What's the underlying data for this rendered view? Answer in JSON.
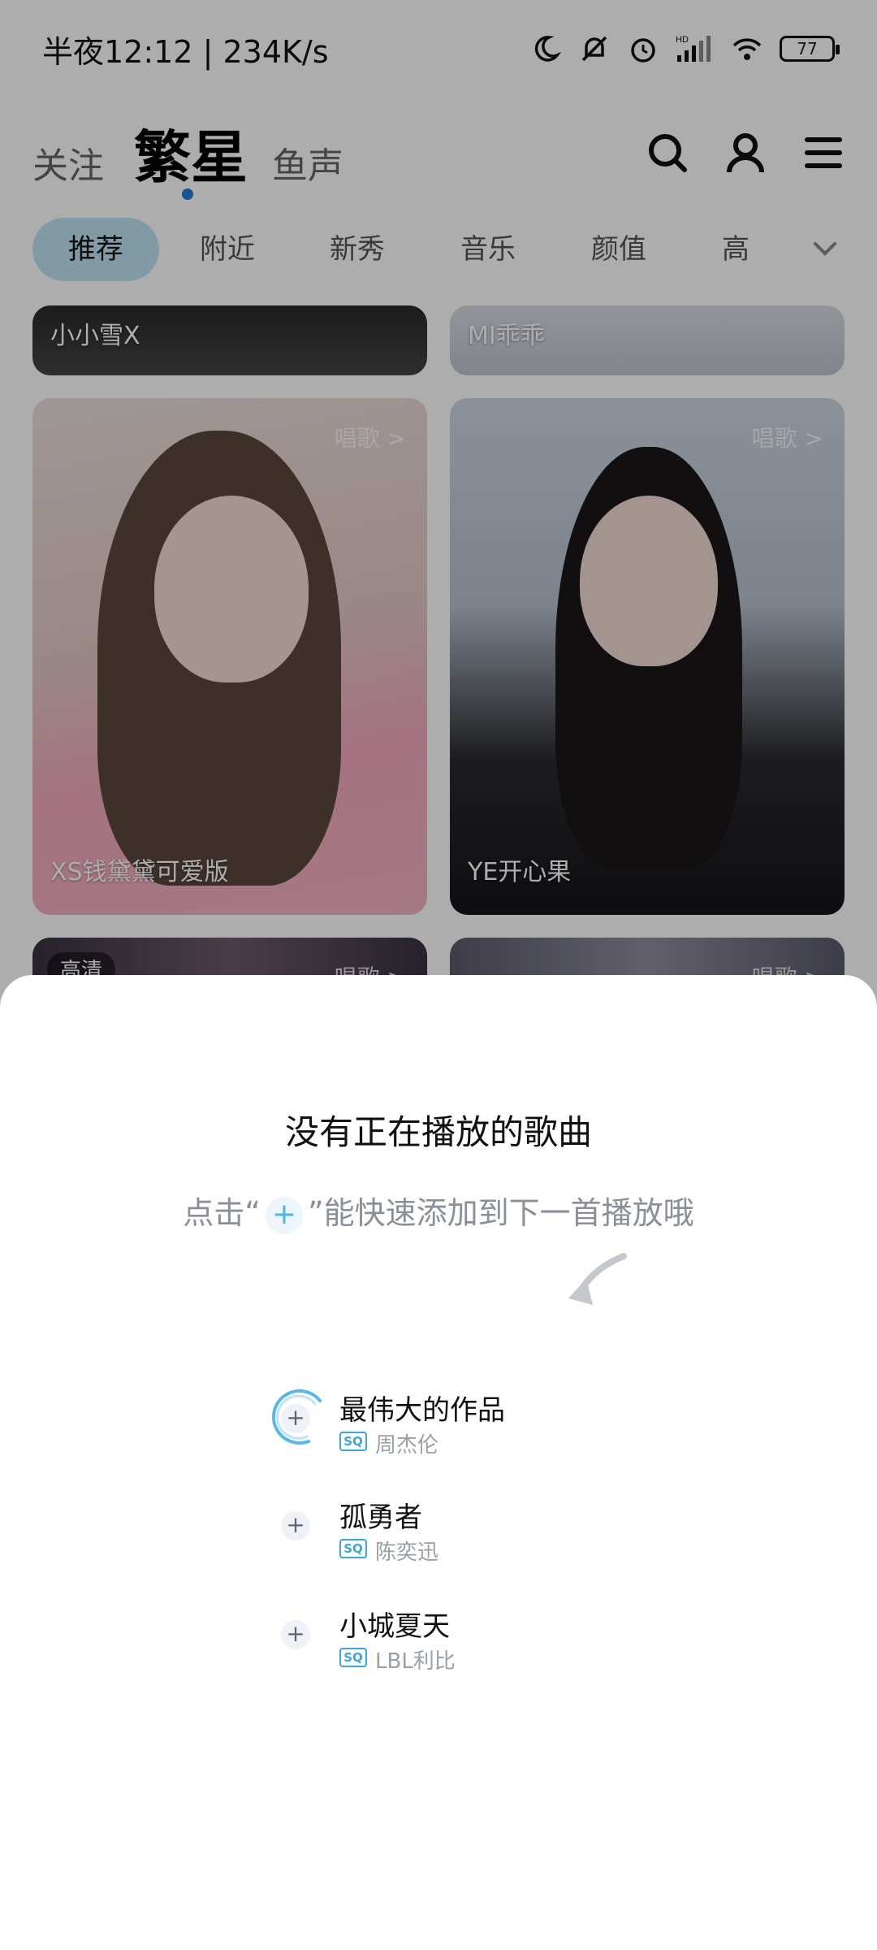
{
  "statusbar": {
    "time": "半夜12:12",
    "speed": "234K/s",
    "battery": "77",
    "icons": [
      "moon-icon",
      "bell-off-icon",
      "alarm-icon",
      "signal-hd-icon",
      "wifi-icon",
      "battery-icon"
    ]
  },
  "topnav": {
    "tab_follow": "关注",
    "tab_star": "繁星",
    "tab_fish": "鱼声",
    "icons": [
      "search-icon",
      "profile-icon",
      "menu-icon"
    ]
  },
  "categories": {
    "items": [
      "推荐",
      "附近",
      "新秀",
      "音乐",
      "颜值",
      "高"
    ],
    "active": "推荐"
  },
  "cards": [
    {
      "name": "小小雪X",
      "tag": ""
    },
    {
      "name": "MI乖乖",
      "tag": ""
    },
    {
      "name": "XS钱黛黛可爱版",
      "tag": "唱歌 >"
    },
    {
      "name": "YE开心果",
      "tag": "唱歌 >"
    },
    {
      "name": "",
      "tag": "唱歌 >",
      "badge": "高清"
    },
    {
      "name": "",
      "tag": "唱歌 >"
    }
  ],
  "sheet": {
    "empty_title": "没有正在播放的歌曲",
    "hint_before": "点击“",
    "hint_plus": "+",
    "hint_after": "”能快速添加到下一首播放哦",
    "songs": [
      {
        "title": "最伟大的作品",
        "quality": "SQ",
        "artist": "周杰伦"
      },
      {
        "title": "孤勇者",
        "quality": "SQ",
        "artist": "陈奕迅"
      },
      {
        "title": "小城夏天",
        "quality": "SQ",
        "artist": "LBL利比"
      }
    ]
  },
  "colors": {
    "accent": "#4ab5e8",
    "active_tab_bg": "#bfe3f3",
    "nav_dot": "#1f7fd1"
  }
}
